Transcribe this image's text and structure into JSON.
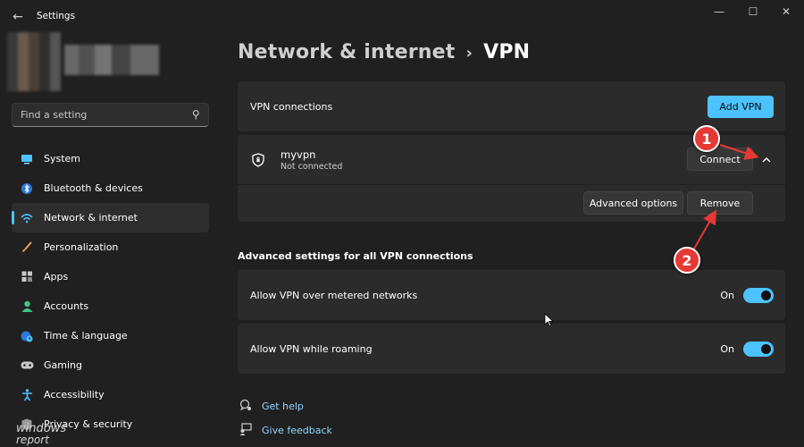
{
  "window": {
    "title": "Settings",
    "controls": {
      "minimize": "—",
      "maximize": "☐",
      "close": "✕"
    }
  },
  "search": {
    "placeholder": "Find a setting"
  },
  "sidebar": {
    "items": [
      {
        "label": "System",
        "icon": "monitor-icon",
        "color": "#4cc2ff"
      },
      {
        "label": "Bluetooth & devices",
        "icon": "bluetooth-icon",
        "color": "#4cc2ff"
      },
      {
        "label": "Network & internet",
        "icon": "wifi-icon",
        "color": "#4cc2ff",
        "active": true
      },
      {
        "label": "Personalization",
        "icon": "brush-icon",
        "color": "#e8a15a"
      },
      {
        "label": "Apps",
        "icon": "apps-icon",
        "color": "#c9c9c9"
      },
      {
        "label": "Accounts",
        "icon": "person-icon",
        "color": "#3ec98a"
      },
      {
        "label": "Time & language",
        "icon": "globe-clock-icon",
        "color": "#4cc2ff"
      },
      {
        "label": "Gaming",
        "icon": "gamepad-icon",
        "color": "#c9c9c9"
      },
      {
        "label": "Accessibility",
        "icon": "accessibility-icon",
        "color": "#4cc2ff"
      },
      {
        "label": "Privacy & security",
        "icon": "shield-icon",
        "color": "#c9c9c9"
      }
    ]
  },
  "breadcrumb": {
    "parent": "Network & internet",
    "separator": "›",
    "current": "VPN"
  },
  "vpn_connections": {
    "label": "VPN connections",
    "add_button": "Add VPN"
  },
  "vpn_item": {
    "name": "myvpn",
    "status": "Not connected",
    "connect_button": "Connect",
    "advanced_button": "Advanced options",
    "remove_button": "Remove"
  },
  "advanced": {
    "title": "Advanced settings for all VPN connections",
    "settings": [
      {
        "label": "Allow VPN over metered networks",
        "state": "On"
      },
      {
        "label": "Allow VPN while roaming",
        "state": "On"
      }
    ]
  },
  "links": {
    "help": "Get help",
    "feedback": "Give feedback"
  },
  "annotations": {
    "one": "1",
    "two": "2"
  },
  "watermark": {
    "line1": "windows",
    "line2": "report"
  },
  "colors": {
    "accent": "#4cc2ff",
    "annotation": "#e53935"
  }
}
